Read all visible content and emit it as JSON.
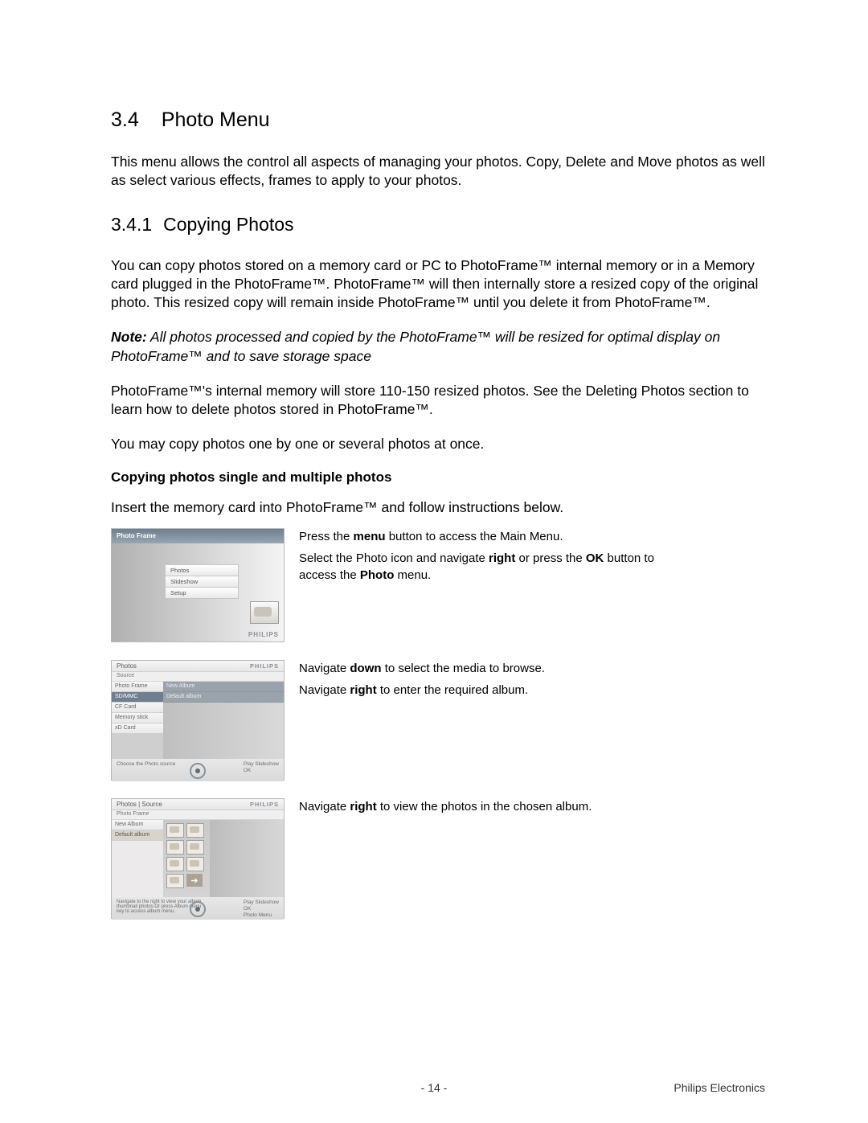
{
  "section": {
    "number": "3.4",
    "title": "Photo Menu",
    "intro": "This menu allows the control all aspects of managing your photos. Copy, Delete and Move photos as well as select various effects, frames to apply to your photos."
  },
  "subsection": {
    "number": "3.4.1",
    "title": "Copying Photos",
    "p1": "You can copy photos stored on a memory card or PC to PhotoFrame™ internal memory or in a Memory card plugged in the PhotoFrame™. PhotoFrame™ will then internally store a resized copy of the original photo. This resized copy will remain inside PhotoFrame™ until you delete it from PhotoFrame™.",
    "note_label": "Note:",
    "note_body": " All photos processed and copied by the PhotoFrame™ will be resized for optimal display on PhotoFrame™ and to save storage space",
    "p2": "PhotoFrame™'s internal memory will store 110-150 resized photos. See the Deleting Photos section to learn how to delete photos stored in PhotoFrame™.",
    "p3": "You may copy photos one by one or several photos at once.",
    "bold_sub": "Copying photos single and multiple photos",
    "p4": "Insert the memory card into PhotoFrame™ and follow instructions below."
  },
  "brand": "PHILIPS",
  "step1": {
    "line1_a": "Press the ",
    "line1_b": "menu",
    "line1_c": " button to access the Main Menu.",
    "line2_a": "Select the Photo icon and navigate ",
    "line2_b": "right",
    "line2_c": " or press the ",
    "line2_d": "OK",
    "line2_e": " button to access the ",
    "line2_f": "Photo",
    "line2_g": " menu.",
    "ui": {
      "header": "Photo Frame",
      "items": [
        "Photos",
        "Slideshow",
        "Setup"
      ]
    }
  },
  "step2": {
    "line1_a": "Navigate ",
    "line1_b": "down",
    "line1_c": " to select the media to browse.",
    "line2_a": "Navigate ",
    "line2_b": "right",
    "line2_c": " to enter the required album.",
    "ui": {
      "top": "Photos",
      "sub": "Source",
      "left": [
        "Photo Frame",
        "SD/MMC",
        "CF Card",
        "Memory stick",
        "xD Card"
      ],
      "right": [
        "New Album",
        "Default album"
      ],
      "foot_left": "Choose the Photo source",
      "foot_r1": "Play Slideshow",
      "foot_r2": "OK"
    }
  },
  "step3": {
    "line1_a": "Navigate ",
    "line1_b": "right",
    "line1_c": " to view the photos in the chosen album.",
    "ui": {
      "top": "Photos | Source",
      "sub": "Photo Frame",
      "left": [
        "New Album",
        "Default album"
      ],
      "foot_left": "Navigate to the right to view your album thumbnail photos.Or press Album menu key to access album menu.",
      "foot_r1": "Play Slideshow",
      "foot_r2": "OK",
      "foot_r3": "Photo Menu"
    }
  },
  "footer": {
    "page": "- 14 -",
    "company": "Philips Electronics"
  }
}
